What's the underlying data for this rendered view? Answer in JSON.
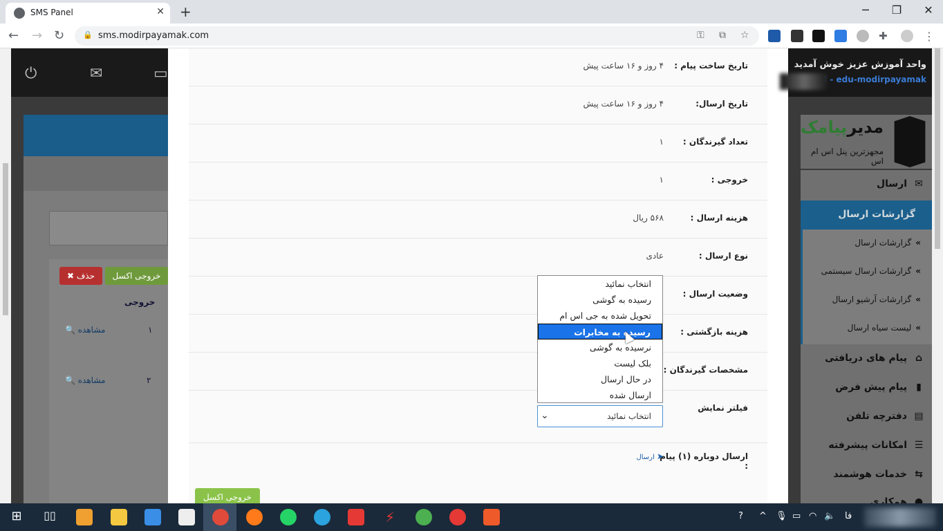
{
  "browser": {
    "tab_title": "SMS Panel",
    "tab_close": "✕",
    "new_tab": "+",
    "url": "sms.modirpayamak.com",
    "controls": {
      "minimize": "─",
      "restore": "❐",
      "close": "✕"
    },
    "nav": {
      "back": "←",
      "forward": "→",
      "reload": "↻"
    }
  },
  "background": {
    "buttons": {
      "delete": "✖ حذف",
      "excel": "خروجی اکسل"
    },
    "column_header": "خروجی",
    "rows": [
      {
        "num": "۱",
        "action": "مشاهده"
      },
      {
        "num": "۲",
        "action": "مشاهده"
      }
    ]
  },
  "sidebar": {
    "welcome": "واحد آموزش عزیز خوش آمدید",
    "username": "edu-modirpayamak",
    "username_prefix": "l -",
    "logo_name_dark": "مدیر",
    "logo_name_green": "پیامک",
    "logo_tagline": "مجهزترین پنل اس ام اس",
    "send": "ارسال",
    "reports_header": "گزارشات ارسال",
    "sub_items": [
      "گزارشات ارسال",
      "گزارشات ارسال سیستمی",
      "گزارشات آرشیو ارسال",
      "لیست سیاه ارسال"
    ],
    "items": [
      "پیام های دریافتی",
      "پیام پیش فرض",
      "دفترچه تلفن",
      "امکانات پیشرفته",
      "خدمات هوشمند",
      "همکاری"
    ]
  },
  "details": {
    "rows": [
      {
        "label": "تاریخ ساخت پیام :",
        "value": "۴ روز و ۱۶ ساعت پیش"
      },
      {
        "label": "تاریخ ارسال:",
        "value": "۴ روز و ۱۶ ساعت پیش"
      },
      {
        "label": "تعداد گیرندگان :",
        "value": "۱"
      },
      {
        "label": "خروجی :",
        "value": "۱"
      },
      {
        "label": "هزینه ارسال :",
        "value": "۵۶۸ ریال"
      },
      {
        "label": "نوع ارسال :",
        "value": "عادی"
      },
      {
        "label": "وضعیت ارسال :",
        "value": ""
      },
      {
        "label": "هزینه بازگشتی :",
        "value": ""
      },
      {
        "label": "مشخصات گیرندگان :",
        "value": ""
      },
      {
        "label": "فیلتر نمایش",
        "value": ""
      }
    ],
    "resend_label": "ارسال دوباره (۱) پیام",
    "resend_colon": ":",
    "resend_link": "ارسال",
    "excel_button": "خروجی اکسل"
  },
  "filter": {
    "selected": "انتخاب نمائید",
    "highlighted_index": 3,
    "options": [
      "انتخاب نمائید",
      "رسیده به گوشی",
      "تحویل شده به جی اس ام",
      "رسیده به مخابرات",
      "نرسیده به گوشی",
      "بلک لیست",
      "در حال ارسال",
      "ارسال شده"
    ]
  },
  "taskbar": {
    "lang": "فا",
    "accent": "#1a2a3a"
  }
}
